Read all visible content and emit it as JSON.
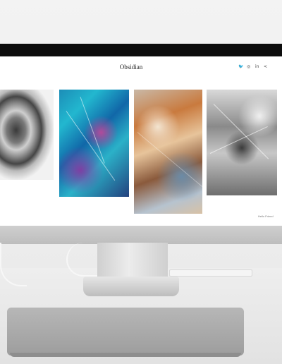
{
  "site": {
    "title": "Obsidian",
    "social_icons": [
      "twitter-icon",
      "instagram-icon",
      "linkedin-icon",
      "share-icon"
    ],
    "social_glyphs": [
      "🐦",
      "◎",
      "in",
      "<"
    ],
    "gallery": [
      "mineral-cluster-artwork",
      "blue-mineral-artwork",
      "desert-terrain-artwork",
      "monochrome-texture-artwork"
    ],
    "footer_link": "Hello Friend"
  },
  "device": {
    "apple_logo": ""
  }
}
